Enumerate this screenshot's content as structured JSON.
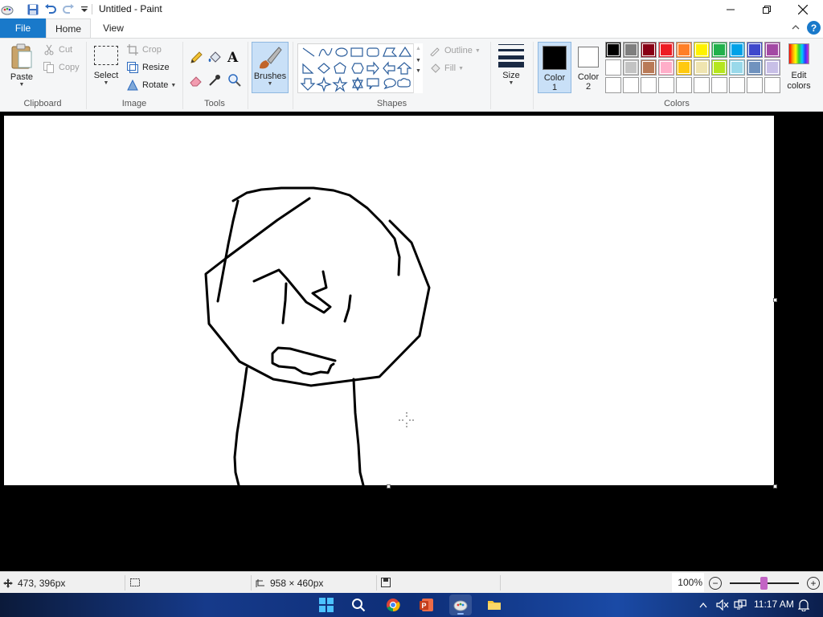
{
  "window": {
    "title": "Untitled - Paint"
  },
  "tabs": [
    {
      "label": "File"
    },
    {
      "label": "Home"
    },
    {
      "label": "View"
    }
  ],
  "help_label": "?",
  "ribbon": {
    "clipboard": {
      "group_label": "Clipboard",
      "paste": "Paste",
      "cut": "Cut",
      "copy": "Copy"
    },
    "image": {
      "group_label": "Image",
      "select": "Select",
      "crop": "Crop",
      "resize": "Resize",
      "rotate": "Rotate"
    },
    "tools": {
      "group_label": "Tools",
      "text_glyph": "A"
    },
    "brushes": {
      "label": "Brushes"
    },
    "shapes": {
      "group_label": "Shapes",
      "outline": "Outline",
      "fill": "Fill"
    },
    "size": {
      "label": "Size"
    },
    "colors": {
      "group_label": "Colors",
      "color1_label_line1": "Color",
      "color1_label_line2": "1",
      "color2_label_line1": "Color",
      "color2_label_line2": "2",
      "edit_line1": "Edit",
      "edit_line2": "colors",
      "color1_value": "#000000",
      "color2_value": "#ffffff",
      "palette_row1": [
        "#000000",
        "#7f7f7f",
        "#880015",
        "#ed1c24",
        "#ff7f27",
        "#fff200",
        "#22b14c",
        "#00a2e8",
        "#3f48cc",
        "#a349a4"
      ],
      "palette_row2": [
        "#ffffff",
        "#c3c3c3",
        "#b97a57",
        "#ffaec9",
        "#ffc90e",
        "#efe4b0",
        "#b5e61d",
        "#99d9ea",
        "#7092be",
        "#c8bfe7"
      ],
      "palette_row3": [
        "#ffffff",
        "#ffffff",
        "#ffffff",
        "#ffffff",
        "#ffffff",
        "#ffffff",
        "#ffffff",
        "#ffffff",
        "#ffffff",
        "#ffffff"
      ]
    }
  },
  "status": {
    "cursor_position": "473, 396px",
    "canvas_size": "958 × 460px",
    "zoom": "100%",
    "zoom_out": "−",
    "zoom_in": "+"
  },
  "taskbar": {
    "time": "11:17 AM",
    "apps": [
      "start-icon",
      "search-icon",
      "chrome-icon",
      "powerpoint-icon",
      "paint-icon",
      "file-explorer-icon"
    ]
  }
}
